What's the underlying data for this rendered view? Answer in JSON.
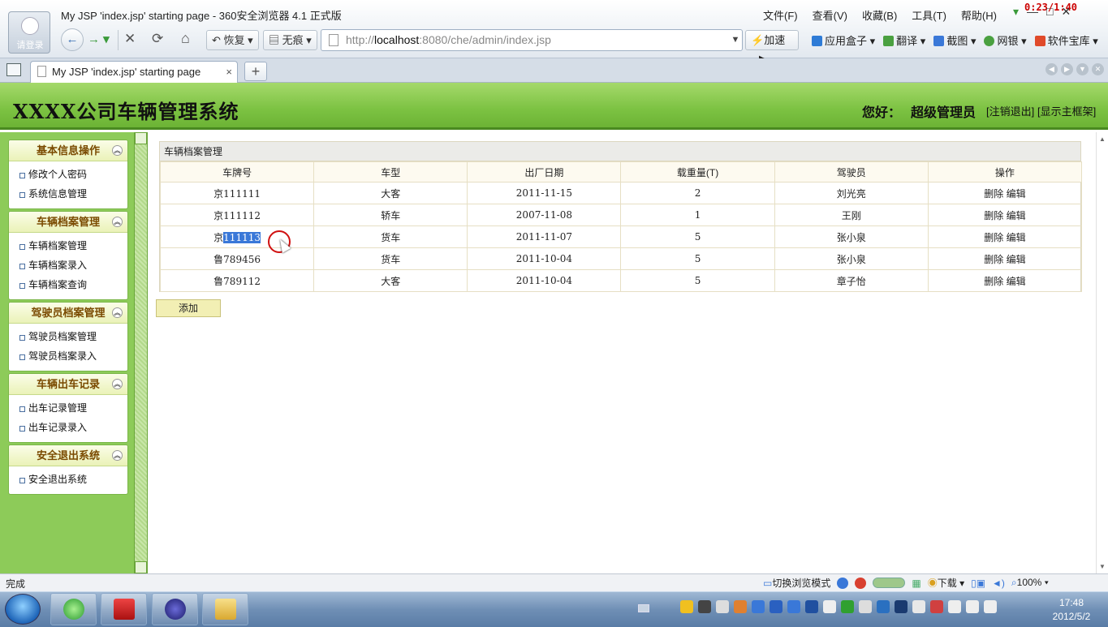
{
  "browser": {
    "window_title": "My JSP 'index.jsp' starting page - 360安全浏览器 4.1 正式版",
    "avatar_label": "请登录",
    "menu": [
      "文件(F)",
      "查看(V)",
      "收藏(B)",
      "工具(T)",
      "帮助(H)"
    ],
    "timer": "0:23/1:40",
    "restore_label": "恢复",
    "notrace_label": "无痕",
    "address_prefix": "http://",
    "address_host": "localhost",
    "address_rest": ":8080/che/admin/index.jsp",
    "speed_label": "加速",
    "apps": [
      {
        "label": "应用盒子",
        "color": "#2e7bd6"
      },
      {
        "label": "翻译",
        "color": "#4aa040"
      },
      {
        "label": "截图",
        "color": "#3a78d8"
      },
      {
        "label": "网银",
        "color": "#4aa040"
      },
      {
        "label": "软件宝库",
        "color": "#e04a2a"
      }
    ],
    "tab_title": "My JSP 'index.jsp' starting page",
    "tab_close": "×",
    "new_tab": "+",
    "status": "完成",
    "switch_mode": "切换浏览模式",
    "download": "下载",
    "zoom": "100%"
  },
  "header": {
    "title": "XXXX公司车辆管理系统",
    "greeting": "您好：",
    "username": "超级管理员",
    "logout": "[注销退出]",
    "show_frame": "[显示主框架]"
  },
  "sidebar": {
    "groups": [
      {
        "title": "基本信息操作",
        "items": [
          "修改个人密码",
          "系统信息管理"
        ]
      },
      {
        "title": "车辆档案管理",
        "items": [
          "车辆档案管理",
          "车辆档案录入",
          "车辆档案查询"
        ]
      },
      {
        "title": "驾驶员档案管理",
        "items": [
          "驾驶员档案管理",
          "驾驶员档案录入"
        ]
      },
      {
        "title": "车辆出车记录",
        "items": [
          "出车记录管理",
          "出车记录录入"
        ]
      },
      {
        "title": "安全退出系统",
        "items": [
          "安全退出系统"
        ]
      }
    ]
  },
  "main": {
    "caption": "车辆档案管理",
    "columns": [
      "车牌号",
      "车型",
      "出厂日期",
      "载重量(T)",
      "驾驶员",
      "操作"
    ],
    "rows": [
      {
        "plate_prefix": "京",
        "plate_num": "111111",
        "type": "大客",
        "date": "2011-11-15",
        "load": "2",
        "driver": "刘光亮"
      },
      {
        "plate_prefix": "京",
        "plate_num": "111112",
        "type": "轿车",
        "date": "2007-11-08",
        "load": "1",
        "driver": "王刚"
      },
      {
        "plate_prefix": "京",
        "plate_num": "111113",
        "type": "货车",
        "date": "2011-11-07",
        "load": "5",
        "driver": "张小泉"
      },
      {
        "plate_prefix": "鲁",
        "plate_num": "789456",
        "type": "货车",
        "date": "2011-10-04",
        "load": "5",
        "driver": "张小泉"
      },
      {
        "plate_prefix": "鲁",
        "plate_num": "789112",
        "type": "大客",
        "date": "2011-10-04",
        "load": "5",
        "driver": "章子怡"
      }
    ],
    "delete_label": "删除",
    "edit_label": "编辑",
    "add_label": "添加"
  },
  "taskbar": {
    "time": "17:48",
    "date": "2012/5/2"
  }
}
